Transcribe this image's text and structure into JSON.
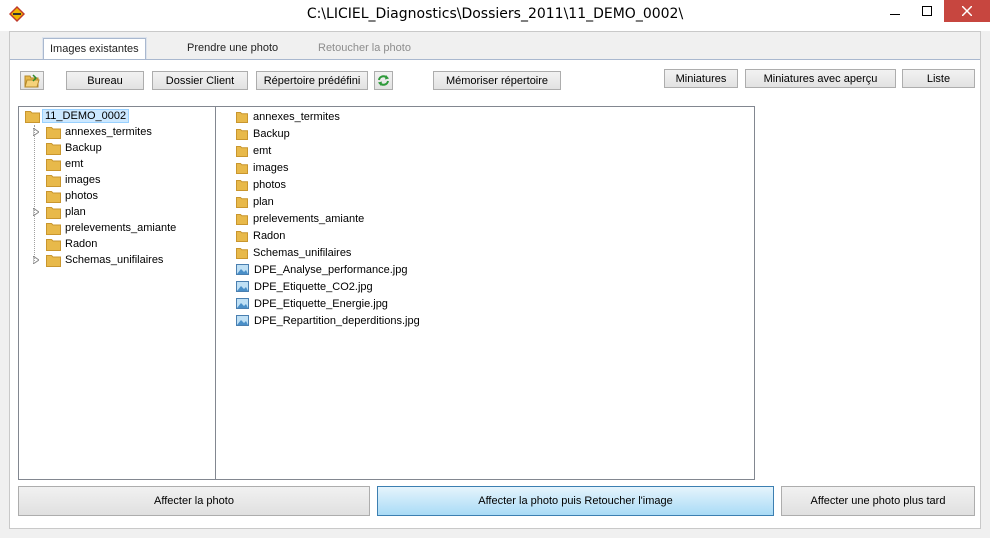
{
  "window": {
    "title": "C:\\LICIEL_Diagnostics\\Dossiers_2011\\11_DEMO_0002\\"
  },
  "tabs": [
    {
      "label": "Images existantes",
      "state": "active"
    },
    {
      "label": "Prendre une photo",
      "state": "normal"
    },
    {
      "label": "Retoucher la photo",
      "state": "disabled"
    }
  ],
  "toolbar": {
    "bureau": "Bureau",
    "dossier_client": "Dossier Client",
    "repertoire_predefini": "Répertoire prédéfini",
    "memoriser": "Mémoriser répertoire",
    "miniatures": "Miniatures",
    "miniatures_apercu": "Miniatures avec aperçu",
    "liste": "Liste"
  },
  "tree": {
    "root": "11_DEMO_0002",
    "children": [
      {
        "label": "annexes_termites",
        "expandable": true
      },
      {
        "label": "Backup",
        "expandable": false
      },
      {
        "label": "emt",
        "expandable": false
      },
      {
        "label": "images",
        "expandable": false
      },
      {
        "label": "photos",
        "expandable": false
      },
      {
        "label": "plan",
        "expandable": true
      },
      {
        "label": "prelevements_amiante",
        "expandable": false
      },
      {
        "label": "Radon",
        "expandable": false
      },
      {
        "label": "Schemas_unifilaires",
        "expandable": true
      }
    ]
  },
  "files": [
    {
      "name": "annexes_termites",
      "kind": "folder"
    },
    {
      "name": "Backup",
      "kind": "folder"
    },
    {
      "name": "emt",
      "kind": "folder"
    },
    {
      "name": "images",
      "kind": "folder"
    },
    {
      "name": "photos",
      "kind": "folder"
    },
    {
      "name": "plan",
      "kind": "folder"
    },
    {
      "name": "prelevements_amiante",
      "kind": "folder"
    },
    {
      "name": "Radon",
      "kind": "folder"
    },
    {
      "name": "Schemas_unifilaires",
      "kind": "folder"
    },
    {
      "name": "DPE_Analyse_performance.jpg",
      "kind": "image"
    },
    {
      "name": "DPE_Etiquette_CO2.jpg",
      "kind": "image"
    },
    {
      "name": "DPE_Etiquette_Energie.jpg",
      "kind": "image"
    },
    {
      "name": "DPE_Repartition_deperditions.jpg",
      "kind": "image"
    }
  ],
  "actions": {
    "affecter": "Affecter la photo",
    "affecter_retoucher": "Affecter la photo puis Retoucher l'image",
    "affecter_plus_tard": "Affecter une photo plus tard"
  },
  "colors": {
    "folder": "#e8b94a",
    "close_button": "#c7463f",
    "selection": "#cce8ff",
    "primary_button": "#a9dbf6"
  }
}
